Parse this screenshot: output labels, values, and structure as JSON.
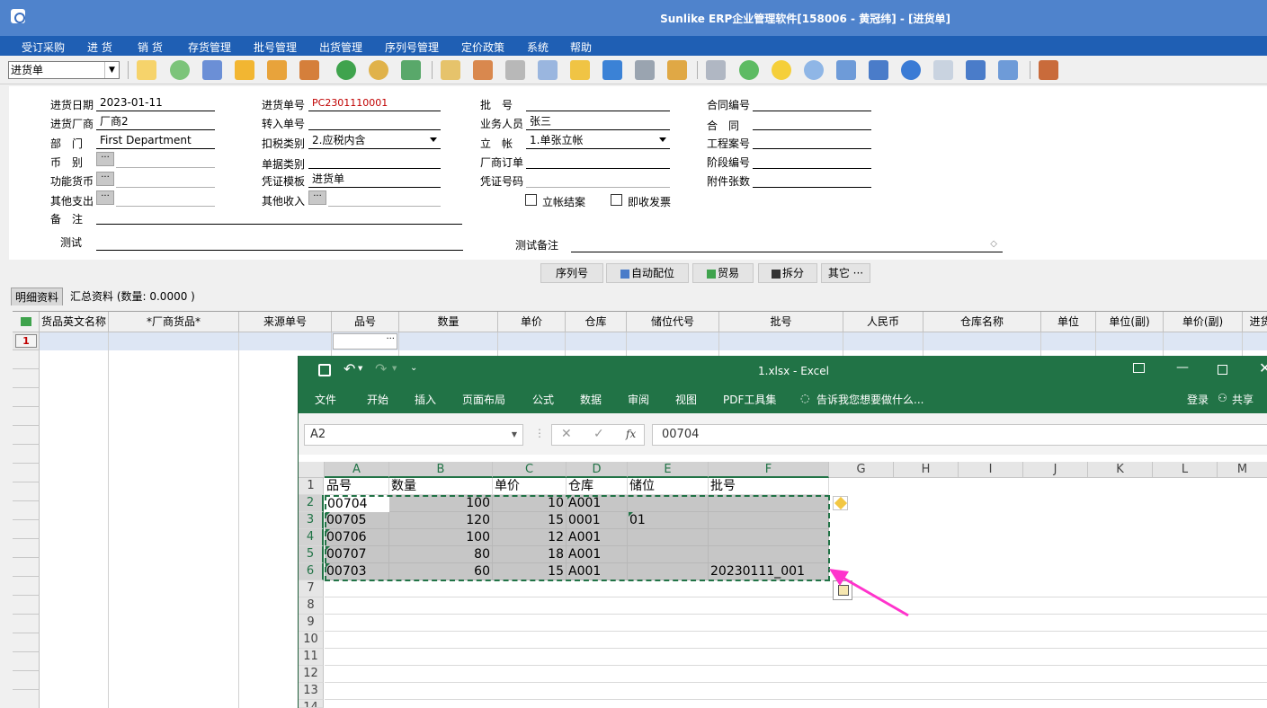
{
  "app": {
    "title": "Sunlike ERP企业管理软件[158006 - 黄冠纬] - [进货单]"
  },
  "menu": [
    "受订采购",
    "进 货",
    "销 货",
    "存货管理",
    "批号管理",
    "出货管理",
    "序列号管理",
    "定价政策",
    "系统",
    "帮助"
  ],
  "toolbar": {
    "doc_type": "进货单"
  },
  "form": {
    "date_label": "进货日期",
    "date_value": "2023-01-11",
    "vendor_label": "进货厂商",
    "vendor_value": "厂商2",
    "dept_label": "部　门",
    "dept_value": "First Department",
    "currency_label": "币　别",
    "func_currency_label": "功能货币",
    "other_expense_label": "其他支出",
    "remark_label": "备　注",
    "test_label": "测试",
    "order_no_label": "进货单号",
    "order_no_value": "PC2301110001",
    "transfer_label": "转入单号",
    "tax_label": "扣税类别",
    "tax_value": "2.应税内含",
    "doc_category_label": "单据类别",
    "voucher_tpl_label": "凭证模板",
    "voucher_tpl_value": "进货单",
    "other_income_label": "其他收入",
    "batch_label": "批　号",
    "sales_person_label": "业务人员",
    "sales_person_value": "张三",
    "account_label": "立　帐",
    "account_value": "1.单张立帐",
    "vendor_order_label": "厂商订单",
    "voucher_no_label": "凭证号码",
    "settle_label": "立帐结案",
    "invoice_label": "即收发票",
    "test_remark_label": "测试备注",
    "contract_no_label": "合同编号",
    "contract_label": "合　同",
    "project_label": "工程案号",
    "stage_label": "阶段编号",
    "attach_label": "附件张数"
  },
  "actions": {
    "serial": "序列号",
    "auto_assign": "自动配位",
    "trade": "贸易",
    "split": "拆分",
    "other": "其它 ···"
  },
  "tabs": {
    "detail": "明细资料",
    "summary": "汇总资料 (数量: 0.0000 )"
  },
  "grid": {
    "columns": [
      "货品英文名称",
      "*厂商货品*",
      "来源单号",
      "品号",
      "数量",
      "单价",
      "仓库",
      "储位代号",
      "批号",
      "人民币",
      "仓库名称",
      "单位",
      "单位(副)",
      "单价(副)",
      "进货"
    ],
    "row1": "1"
  },
  "excel": {
    "title": "1.xlsx - Excel",
    "ribbon_tabs": [
      "文件",
      "开始",
      "插入",
      "页面布局",
      "公式",
      "数据",
      "审阅",
      "视图",
      "PDF工具集"
    ],
    "tell_me": "告诉我您想要做什么...",
    "login": "登录",
    "share": "共享",
    "namebox": "A2",
    "formula_value": "00704",
    "columns": [
      "A",
      "B",
      "C",
      "D",
      "E",
      "F",
      "G",
      "H",
      "I",
      "J",
      "K",
      "L",
      "M"
    ],
    "rows": [
      "1",
      "2",
      "3",
      "4",
      "5",
      "6",
      "7",
      "8",
      "9",
      "10",
      "11",
      "12",
      "13",
      "14"
    ],
    "header_row": [
      "品号",
      "数量",
      "单价",
      "仓库",
      "储位",
      "批号"
    ],
    "data_rows": [
      [
        "00704",
        "100",
        "10",
        "A001",
        "",
        ""
      ],
      [
        "00705",
        "120",
        "15",
        "0001",
        "01",
        ""
      ],
      [
        "00706",
        "100",
        "12",
        "A001",
        "",
        ""
      ],
      [
        "00707",
        "80",
        "18",
        "A001",
        "",
        ""
      ],
      [
        "00703",
        "60",
        "15",
        "A001",
        "",
        "20230111_001"
      ]
    ]
  },
  "colors": {
    "titlebar": "#4f83cc",
    "menubar": "#1f5fb4",
    "excel_green": "#217346",
    "arrow": "#ff33cc"
  }
}
